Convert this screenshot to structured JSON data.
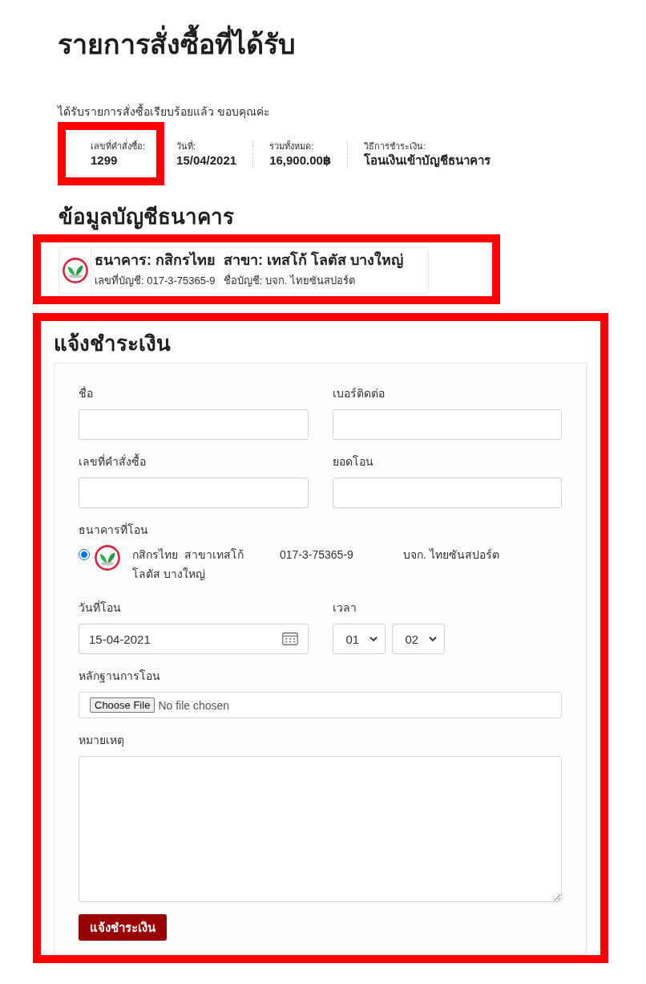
{
  "page": {
    "title": "รายการสั่งซื้อที่ได้รับ",
    "notice": "ได้รับรายการสั่งซื้อเรียบร้อยแล้ว ขอบคุณค่ะ"
  },
  "order_overview": [
    {
      "label": "เลขที่คำสั่งซื้อ:",
      "value": "1299",
      "highlighted": true
    },
    {
      "label": "วันที่:",
      "value": "15/04/2021",
      "highlighted": false
    },
    {
      "label": "รวมทั้งหมด:",
      "value": "16,900.00฿",
      "highlighted": false
    },
    {
      "label": "วิธีการชำระเงิน:",
      "value": "โอนเงินเข้าบัญชีธนาคาร",
      "highlighted": false
    }
  ],
  "bank_details": {
    "heading": "ข้อมูลบัญชีธนาคาร",
    "highlighted": true,
    "accounts": [
      {
        "bank": "ธนาคาร: กสิกรไทย",
        "branch": "สาขา: เทสโก้ โลตัส บางใหญ่",
        "account_number": "เลขที่บัญชี: 017-3-75365-9",
        "account_name": "ชื่อบัญชี: บจก. ไทยซันสปอร์ต"
      }
    ]
  },
  "payment_form": {
    "heading": "แจ้งชำระเงิน",
    "highlighted": true,
    "fields": [
      {
        "label": "ชื่อ"
      },
      {
        "label": "เบอร์ติดต่อ"
      },
      {
        "label": "เลขที่คำสั่งซื้อ"
      },
      {
        "label": "ยอดโอน"
      }
    ],
    "bank_choice": {
      "label": "ธนาคารที่โอน",
      "options": [
        {
          "selected": true,
          "bank_branch": "กสิกรไทย  สาขาเทสโก้ โลตัส บางใหญ่",
          "account_number": "017-3-75365-9",
          "account_name": "บจก. ไทยซันสปอร์ต"
        }
      ]
    },
    "transfer_date": {
      "label": "วันที่โอน",
      "value": "15-04-2021"
    },
    "transfer_time": {
      "label": "เวลา",
      "hour": "01",
      "minute": "02"
    },
    "slip_upload": {
      "label": "หลักฐานการโอน",
      "button": "Choose File",
      "status": "No file chosen"
    },
    "note": {
      "label": "หมายเหตุ"
    },
    "submit": "แจ้งชำระเงิน"
  }
}
